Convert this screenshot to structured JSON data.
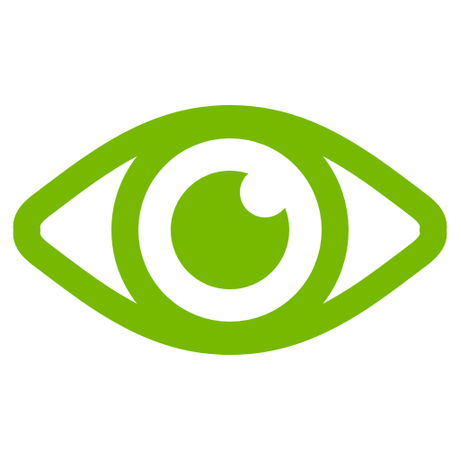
{
  "icon": {
    "name": "eye-icon",
    "color": "#76b900",
    "background": "#ffffff"
  }
}
